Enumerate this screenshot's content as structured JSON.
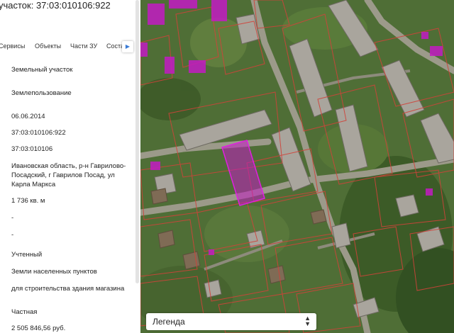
{
  "panel": {
    "title": "участок: 37:03:010106:922",
    "tabs": [
      "Сервисы",
      "Объекты",
      "Части ЗУ",
      "Соста"
    ],
    "tab_next_icon": "chevron-right-icon",
    "rows": [
      "Земельный участок",
      "Землепользование",
      "06.06.2014",
      "37:03:010106:922",
      "37:03:010106",
      "Ивановская область, р-н Гаврилово-Посадский, г Гаврилов Посад, ул Карла Маркса",
      "1 736 кв. м",
      "-",
      "-",
      "Учтенный",
      "Земли населенных пунктов",
      "для строительства здания магазина",
      "Частная",
      "2 505 846,56 руб."
    ]
  },
  "map": {
    "legend_label": "Легенда",
    "legend_icon": "chevron-up-down-icon",
    "parcel_highlight_color": "#d01fd0",
    "parcel_border_color": "#d0433a"
  }
}
